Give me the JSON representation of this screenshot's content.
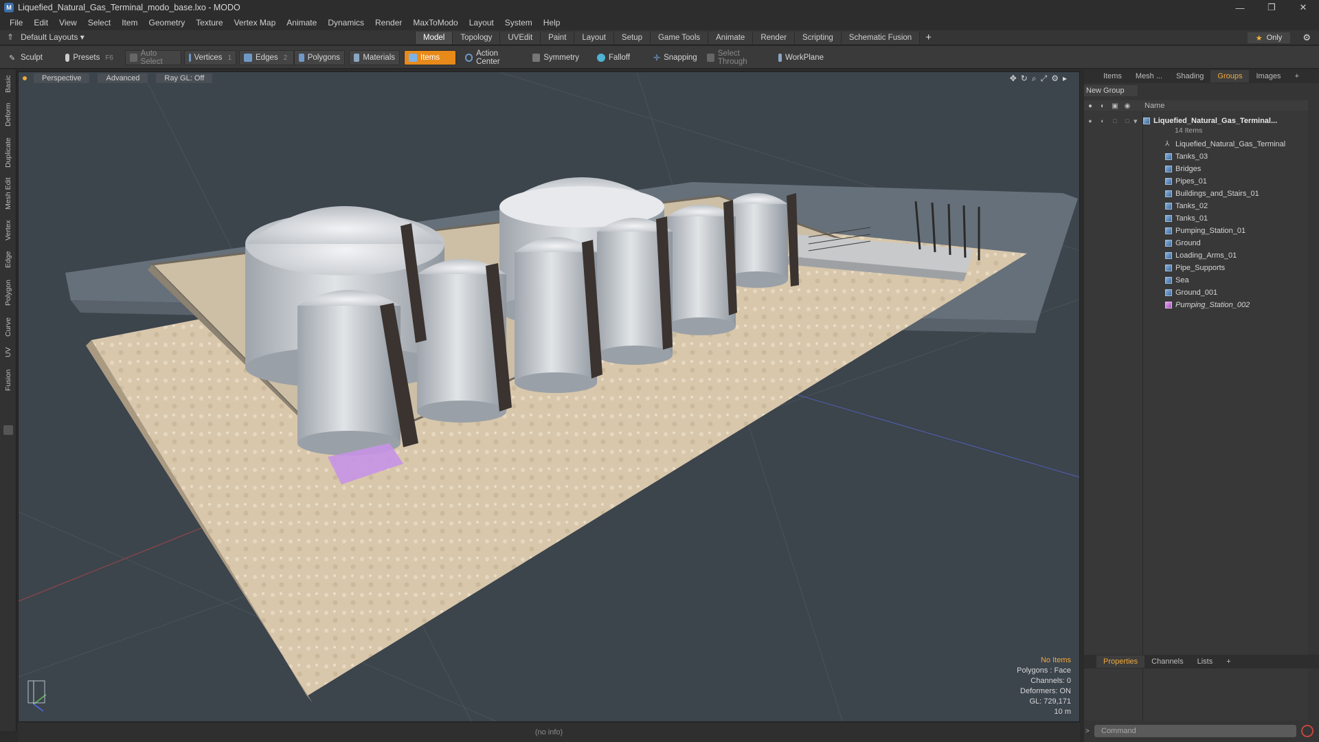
{
  "window": {
    "title": "Liquefied_Natural_Gas_Terminal_modo_base.lxo - MODO",
    "controls": [
      "—",
      "❐",
      "✕"
    ]
  },
  "menu": [
    "File",
    "Edit",
    "View",
    "Select",
    "Item",
    "Geometry",
    "Texture",
    "Vertex Map",
    "Animate",
    "Dynamics",
    "Render",
    "MaxToModo",
    "Layout",
    "System",
    "Help"
  ],
  "layoutbar": {
    "dropdown": "Default Layouts ▾",
    "tabs": [
      "Model",
      "Topology",
      "UVEdit",
      "Paint",
      "Layout",
      "Setup",
      "Game Tools",
      "Animate",
      "Render",
      "Scripting",
      "Schematic Fusion"
    ],
    "active_tab": "Model",
    "only_label": "Only"
  },
  "toolbar": {
    "sculpt": "Sculpt",
    "presets": "Presets",
    "presets_key": "F6",
    "auto_select": "Auto Select",
    "vertices": "Vertices",
    "vertices_count": "1",
    "edges": "Edges",
    "edges_count": "2",
    "polygons": "Polygons",
    "materials": "Materials",
    "items": "Items",
    "action_center": "Action Center",
    "symmetry": "Symmetry",
    "falloff": "Falloff",
    "snapping": "Snapping",
    "select_through": "Select Through",
    "workplane": "WorkPlane"
  },
  "left_tabs": [
    "Basic",
    "Deform",
    "Duplicate",
    "Mesh Edit",
    "Vertex",
    "Edge",
    "Polygon",
    "Curve",
    "UV",
    "Fusion"
  ],
  "viewport": {
    "view": "Perspective",
    "shading": "Advanced",
    "raygl": "Ray GL: Off",
    "hud": {
      "selection": "No Items",
      "polygons": "Polygons : Face",
      "channels": "Channels: 0",
      "deformers": "Deformers: ON",
      "gl": "GL: 729,171",
      "scale": "10 m"
    }
  },
  "status": "(no info)",
  "right_panel": {
    "tabs": [
      "Items",
      "Mesh ...",
      "Shading",
      "Groups",
      "Images"
    ],
    "active_tab": "Groups",
    "new_group": "New Group",
    "column_name": "Name",
    "root": {
      "label": "Liquefied_Natural_Gas_Terminal...",
      "count": "14 Items"
    },
    "items": [
      {
        "label": "Liquefied_Natural_Gas_Terminal",
        "icon": "locator-icon"
      },
      {
        "label": "Tanks_03",
        "icon": "mesh-icon"
      },
      {
        "label": "Bridges",
        "icon": "mesh-icon"
      },
      {
        "label": "Pipes_01",
        "icon": "mesh-icon"
      },
      {
        "label": "Buildings_and_Stairs_01",
        "icon": "mesh-icon"
      },
      {
        "label": "Tanks_02",
        "icon": "mesh-icon"
      },
      {
        "label": "Tanks_01",
        "icon": "mesh-icon"
      },
      {
        "label": "Pumping_Station_01",
        "icon": "mesh-icon"
      },
      {
        "label": "Ground",
        "icon": "mesh-icon"
      },
      {
        "label": "Loading_Arms_01",
        "icon": "mesh-icon"
      },
      {
        "label": "Pipe_Supports",
        "icon": "mesh-icon"
      },
      {
        "label": "Sea",
        "icon": "mesh-icon"
      },
      {
        "label": "Ground_001",
        "icon": "mesh-icon"
      },
      {
        "label": "Pumping_Station_002",
        "icon": "mesh-icon-selected"
      }
    ],
    "bottom_tabs": [
      "Properties",
      "Channels",
      "Lists"
    ],
    "bottom_active": "Properties",
    "command_placeholder": "Command"
  }
}
